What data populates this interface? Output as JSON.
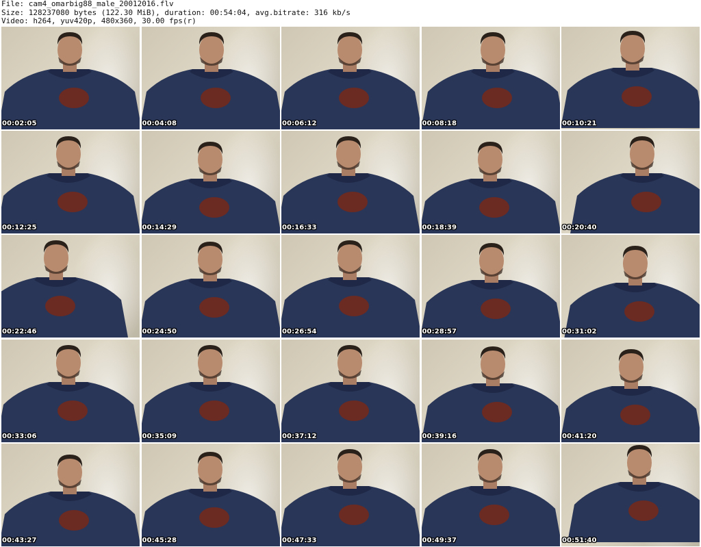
{
  "header": {
    "file_line": "File: cam4_omarbig88_male_20012016.flv",
    "size_line": "Size: 128237080 bytes (122.30 MiB), duration: 00:54:04, avg.bitrate: 316 kb/s",
    "video_line": "Video: h264, yuv420p, 480x360, 30.00 fps(r)"
  },
  "thumbnails": [
    {
      "time": "00:02:05"
    },
    {
      "time": "00:04:08"
    },
    {
      "time": "00:06:12"
    },
    {
      "time": "00:08:18"
    },
    {
      "time": "00:10:21"
    },
    {
      "time": "00:12:25"
    },
    {
      "time": "00:14:29"
    },
    {
      "time": "00:16:33"
    },
    {
      "time": "00:18:39"
    },
    {
      "time": "00:20:40"
    },
    {
      "time": "00:22:46"
    },
    {
      "time": "00:24:50"
    },
    {
      "time": "00:26:54"
    },
    {
      "time": "00:28:57"
    },
    {
      "time": "00:31:02"
    },
    {
      "time": "00:33:06"
    },
    {
      "time": "00:35:09"
    },
    {
      "time": "00:37:12"
    },
    {
      "time": "00:39:16"
    },
    {
      "time": "00:41:20"
    },
    {
      "time": "00:43:27"
    },
    {
      "time": "00:45:28"
    },
    {
      "time": "00:47:33"
    },
    {
      "time": "00:49:37"
    },
    {
      "time": "00:51:40"
    }
  ]
}
